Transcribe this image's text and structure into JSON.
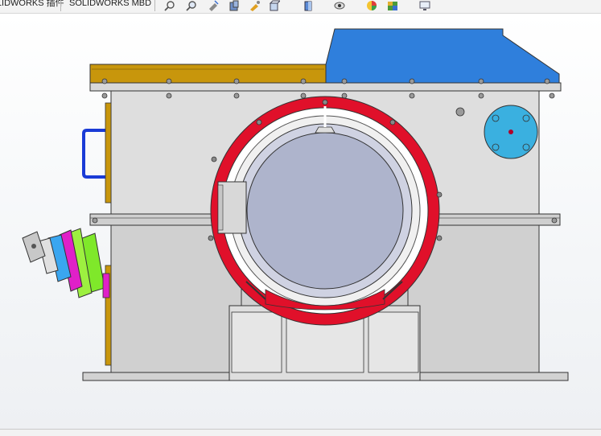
{
  "command_manager": {
    "tabs": [
      {
        "label": "SOLIDWORKS 插件"
      },
      {
        "label": "SOLIDWORKS MBD"
      }
    ]
  },
  "heads_up_toolbar": {
    "tools": [
      {
        "icon": "zoom-to-fit-icon"
      },
      {
        "icon": "zoom-to-area-icon"
      },
      {
        "icon": "previous-view-icon"
      },
      {
        "icon": "section-view-icon"
      },
      {
        "icon": "dynamic-annotation-icon"
      },
      {
        "icon": "view-orientation-icon"
      },
      {
        "icon": "display-style-icon"
      },
      {
        "icon": "hide-show-items-icon"
      },
      {
        "icon": "edit-appearance-icon"
      },
      {
        "icon": "apply-scene-icon"
      },
      {
        "icon": "view-settings-icon"
      }
    ]
  },
  "colors": {
    "housing_lid": "#c8960c",
    "gearbox_cover": "#2f7fdc",
    "ring_flange": "#e0102a",
    "housing_body": "#d6d6d6",
    "drum": "#aeb4cc",
    "side_flange": "#3ab0e0",
    "handle": "#1a3bd6",
    "shaft_coupling_green": "#7fe82a",
    "shaft_coupling_magenta": "#e020c8",
    "shaft_coupling_blue": "#3aa6f0"
  }
}
